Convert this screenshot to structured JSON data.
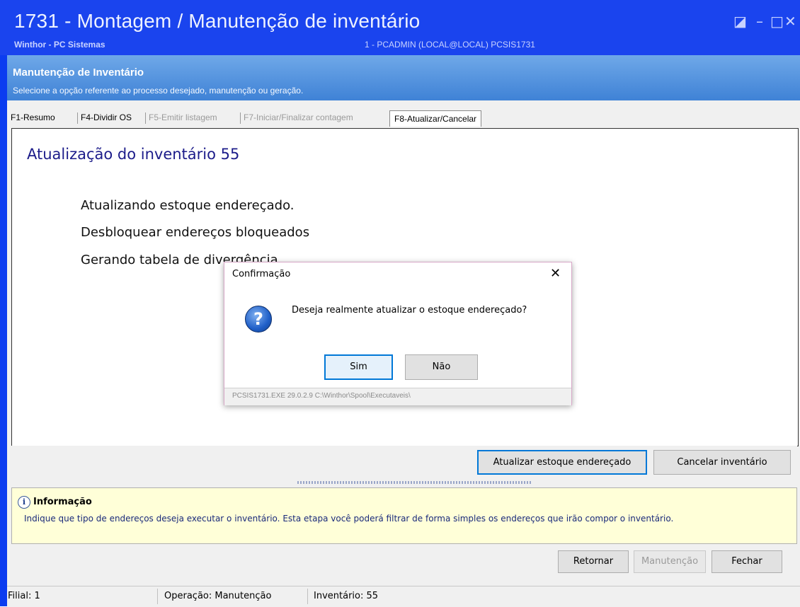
{
  "window": {
    "title": "1731 - Montagem / Manutenção de inventário",
    "app": "Winthor - PC Sistemas",
    "user": "1 - PCADMIN (LOCAL@LOCAL)   PCSIS1731",
    "controls": {
      "restore": "◪",
      "minimize": "–",
      "maximize": "□",
      "close": "✕"
    }
  },
  "header": {
    "title": "Manutenção de Inventário",
    "subtitle": "Selecione a opção referente ao processo desejado, manutenção ou geração."
  },
  "tabs": [
    {
      "label": "F1-Resumo",
      "disabled": false
    },
    {
      "label": "F4-Dividir OS",
      "disabled": false
    },
    {
      "label": "F5-Emitir listagem",
      "disabled": true
    },
    {
      "label": "F7-Iniciar/Finalizar contagem",
      "disabled": true
    },
    {
      "label": "F8-Atualizar/Cancelar",
      "active": true
    }
  ],
  "panel": {
    "title": "Atualização do inventário 55",
    "steps": [
      "Atualizando estoque endereçado.",
      "Desbloquear endereços bloqueados",
      "Gerando tabela de divergência"
    ]
  },
  "actions": {
    "update": "Atualizar estoque endereçado",
    "cancel": "Cancelar inventário"
  },
  "info": {
    "title": "Informação",
    "text": "Indique que tipo de endereços deseja executar o inventário. Esta etapa você poderá filtrar de forma simples os endereços que irão compor o inventário."
  },
  "footer_buttons": {
    "back": "Retornar",
    "maintenance": "Manutenção",
    "close": "Fechar"
  },
  "status": {
    "branch": "Filial: 1",
    "operation": "Operação: Manutenção",
    "inventory": "Inventário: 55"
  },
  "dialog": {
    "title": "Confirmação",
    "close_glyph": "✕",
    "question_glyph": "?",
    "message": "Deseja realmente atualizar o estoque endereçado?",
    "yes": "Sim",
    "no": "Não",
    "footer": "PCSIS1731.EXE 29.0.2.9 C:\\Winthor\\Spool\\Executaveis\\"
  },
  "info_glyph": "i",
  "colors": {
    "titlebar": "#1a44ee",
    "header": "#4a8ad8",
    "info_bg": "#ffffd8",
    "focus": "#0078d7"
  }
}
